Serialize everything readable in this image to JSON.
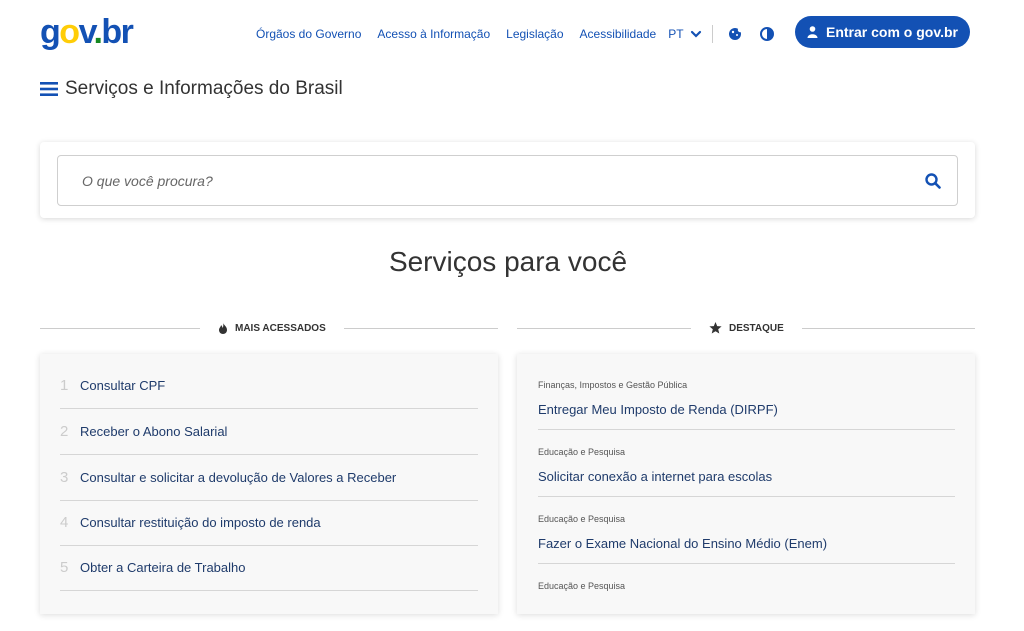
{
  "header": {
    "logo": {
      "g": "g",
      "o": "o",
      "v": "v",
      "dot": ".",
      "br": "br"
    },
    "nav_links": [
      "Órgãos do Governo",
      "Acesso à Informação",
      "Legislação",
      "Acessibilidade"
    ],
    "language": "PT",
    "login_label": "Entrar com o gov.br"
  },
  "menu": {
    "title": "Serviços e Informações do Brasil"
  },
  "search": {
    "placeholder": "O que você procura?"
  },
  "section_title": "Serviços para você",
  "most_accessed": {
    "heading": "MAIS ACESSADOS",
    "items": [
      {
        "num": "1",
        "label": "Consultar CPF"
      },
      {
        "num": "2",
        "label": "Receber o Abono Salarial"
      },
      {
        "num": "3",
        "label": "Consultar e solicitar a devolução de Valores a Receber"
      },
      {
        "num": "4",
        "label": "Consultar restituição do imposto de renda"
      },
      {
        "num": "5",
        "label": "Obter a Carteira de Trabalho"
      }
    ]
  },
  "highlights": {
    "heading": "DESTAQUE",
    "items": [
      {
        "category": "Finanças, Impostos e Gestão Pública",
        "title": "Entregar Meu Imposto de Renda (DIRPF)"
      },
      {
        "category": "Educação e Pesquisa",
        "title": "Solicitar conexão a internet para escolas"
      },
      {
        "category": "Educação e Pesquisa",
        "title": "Fazer o Exame Nacional do Ensino Médio (Enem)"
      },
      {
        "category": "Educação e Pesquisa",
        "title": ""
      }
    ]
  },
  "colors": {
    "primary": "#1351b4",
    "yellow": "#ffcd07",
    "green": "#168821"
  },
  "icons": [
    "hamburger-icon",
    "search-icon",
    "flame-icon",
    "star-icon",
    "user-icon",
    "cookie-icon",
    "contrast-icon",
    "chevron-down-icon"
  ]
}
